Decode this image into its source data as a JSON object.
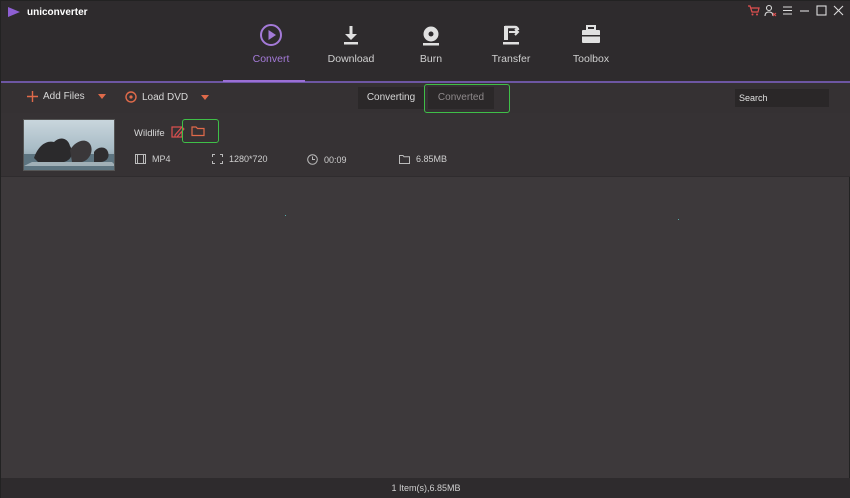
{
  "app": {
    "title": "uniconverter"
  },
  "nav": [
    {
      "label": "Convert",
      "icon": "convert-icon",
      "active": true
    },
    {
      "label": "Download",
      "icon": "download-icon"
    },
    {
      "label": "Burn",
      "icon": "burn-icon"
    },
    {
      "label": "Transfer",
      "icon": "transfer-icon"
    },
    {
      "label": "Toolbox",
      "icon": "toolbox-icon"
    }
  ],
  "toolbar": {
    "add_files": "Add Files",
    "load_dvd": "Load DVD",
    "tab_converting": "Converting",
    "tab_converted": "Converted",
    "search_placeholder": "Search"
  },
  "file": {
    "name": "Wildlife",
    "format": "MP4",
    "resolution": "1280*720",
    "duration": "00:09",
    "size": "6.85MB"
  },
  "status": {
    "summary": "1 Item(s),6.85MB"
  },
  "colors": {
    "accent": "#9b6fd6",
    "orange": "#e06a4a",
    "highlight": "#3fbf48"
  }
}
